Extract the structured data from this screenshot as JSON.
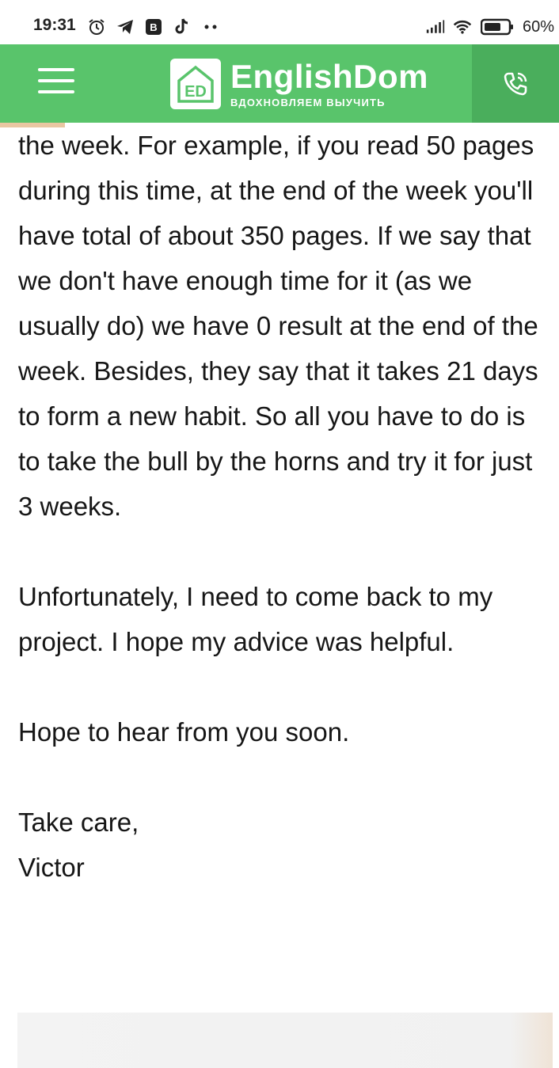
{
  "status_bar": {
    "time": "19:31",
    "battery": "60%",
    "left_icons": [
      "alarm-icon",
      "telegram-icon",
      "vk-icon",
      "tiktok-icon",
      "more-dots-icon"
    ],
    "right_icons": [
      "signal-icon",
      "wifi-icon",
      "battery-icon"
    ]
  },
  "header": {
    "logo_mark": "ED",
    "brand": "EnglishDom",
    "tagline": "ВДОХНОВЛЯЕМ ВЫУЧИТЬ",
    "colors": {
      "bar": "#59c46b",
      "call_bg": "#4aae5c",
      "progress": "#e9c7a2"
    }
  },
  "article": {
    "paragraphs": [
      "the week. For example, if you read 50 pages during this time, at the end of the week you'll have total of about 350 pages. If we say that we don't have enough time for it (as we usually do) we have 0 result at the end of the week. Besides, they say that it takes 21 days to form a new habit. So all you have to do is to take the bull by the horns and try it for just 3 weeks.",
      "Unfortunately, I need to come back to my project. I hope my advice was helpful.",
      "Hope to hear from you soon."
    ],
    "closing": "Take care,",
    "signature": "Victor"
  }
}
